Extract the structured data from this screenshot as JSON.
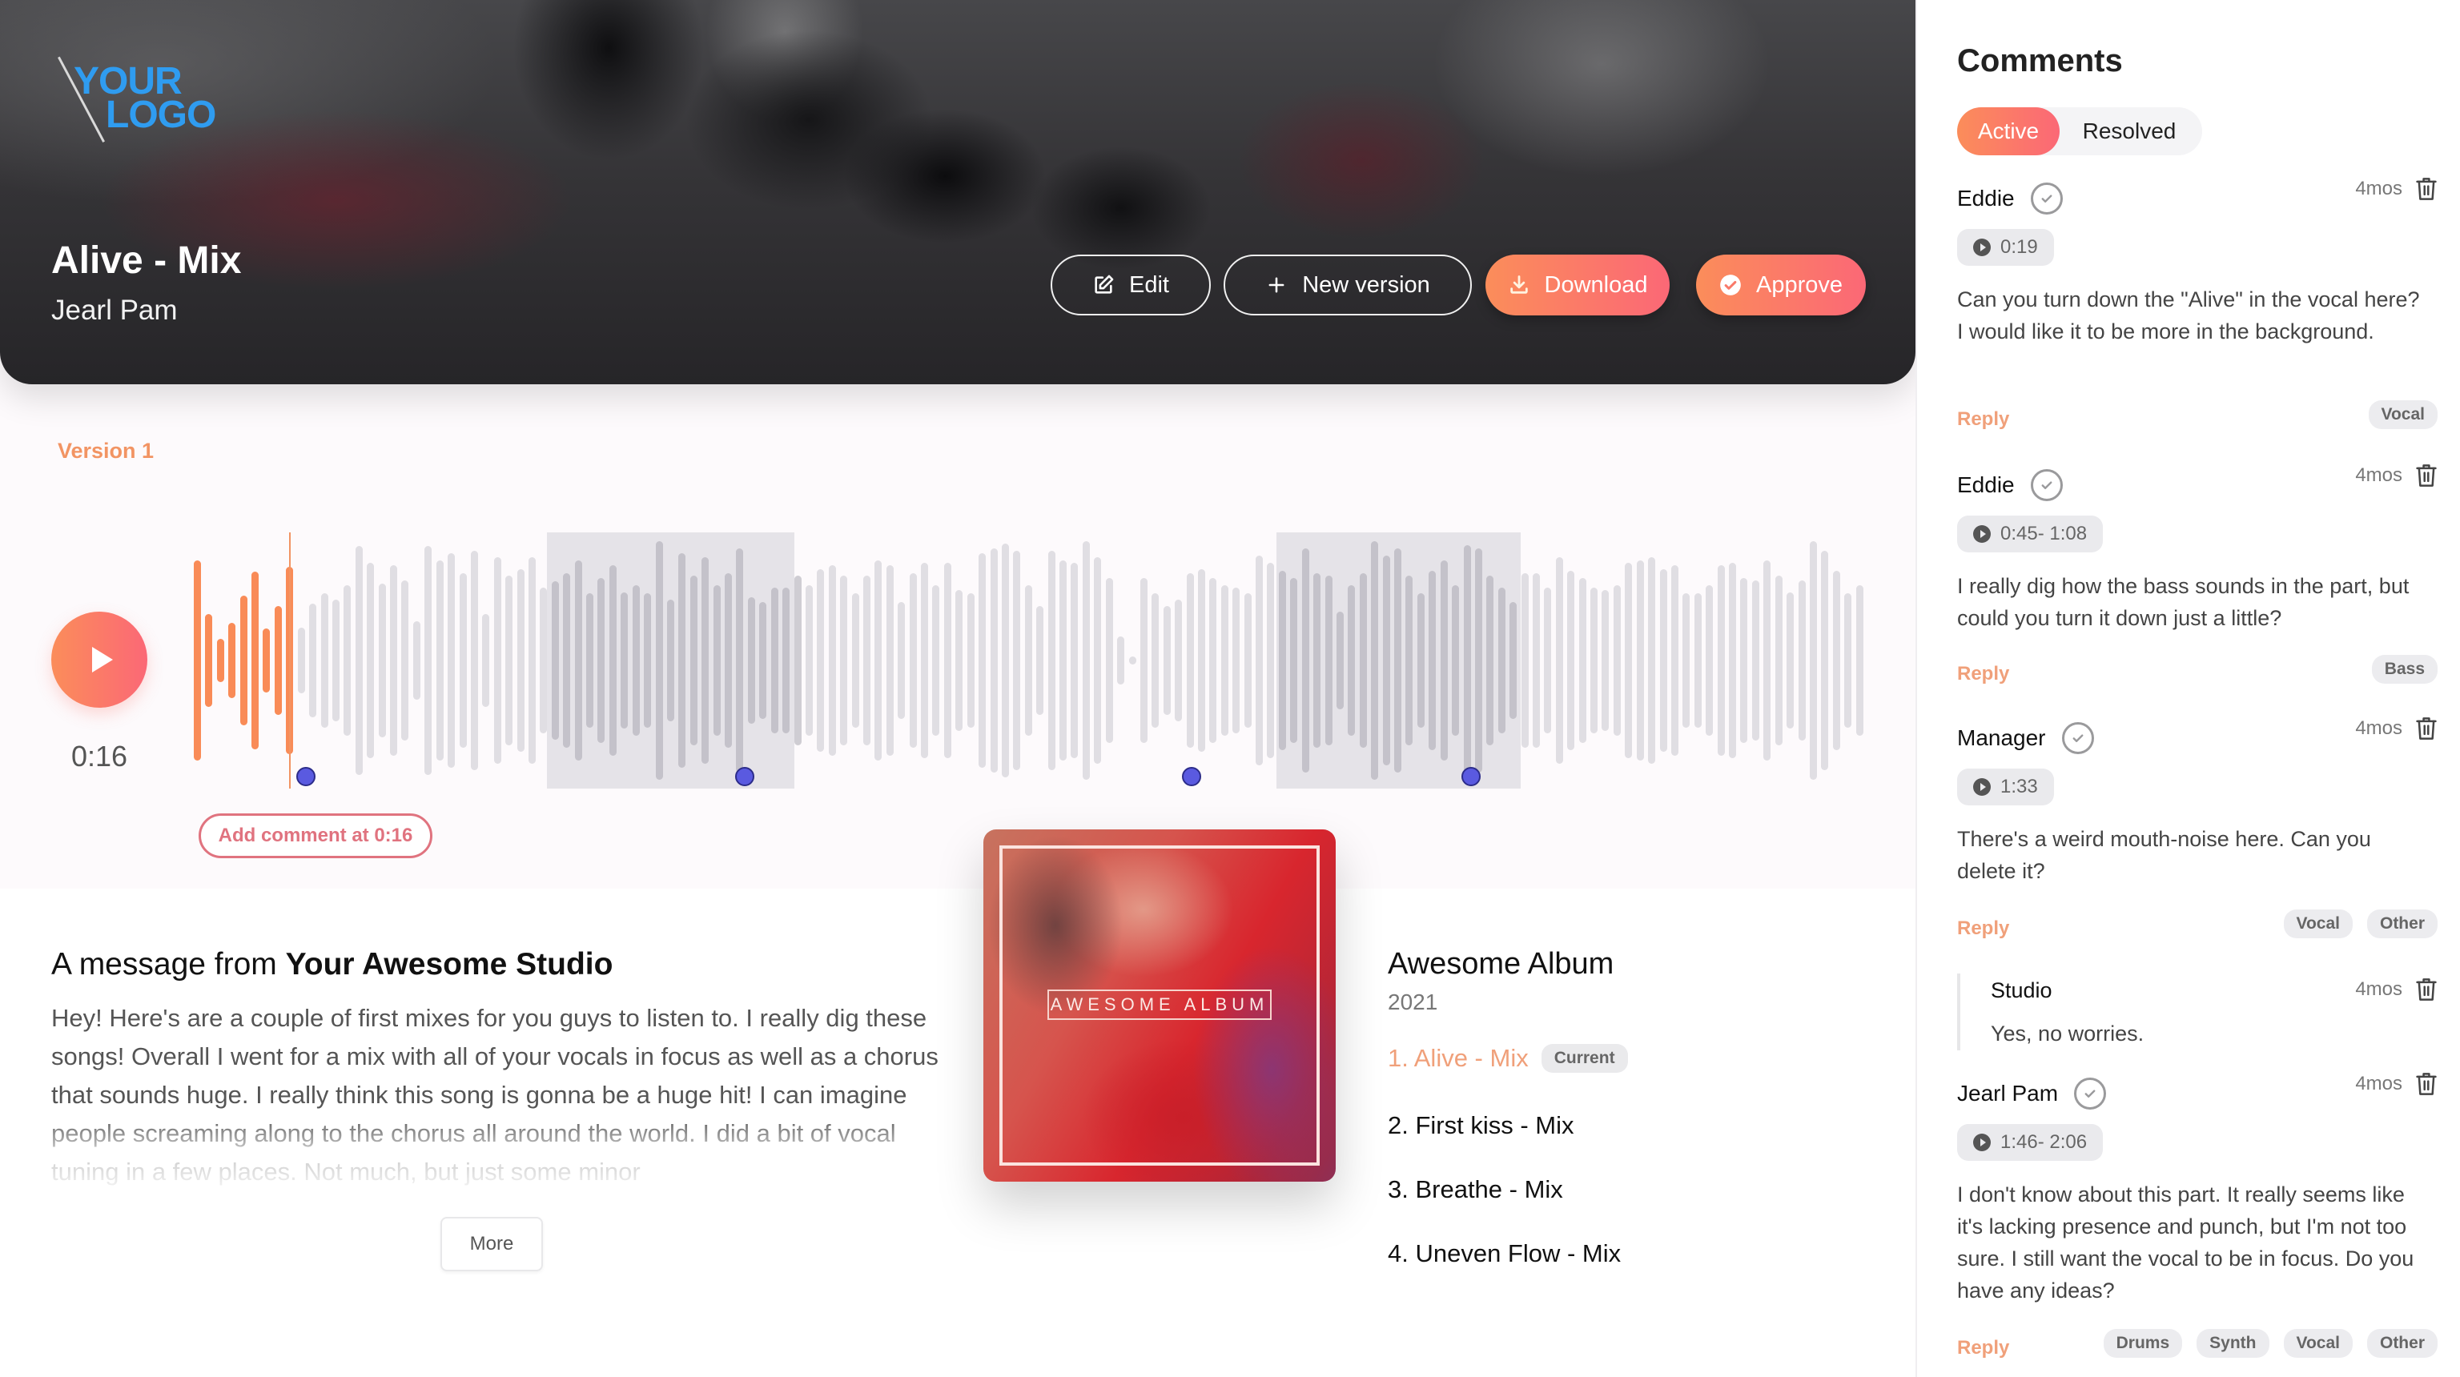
{
  "header": {
    "logo_line1": "YOUR",
    "logo_line2": "LOGO",
    "track_title": "Alive - Mix",
    "artist": "Jearl Pam",
    "buttons": {
      "edit": "Edit",
      "new_version": "New version",
      "download": "Download",
      "approve": "Approve"
    }
  },
  "player": {
    "version_label": "Version 1",
    "current_time": "0:16",
    "add_comment_label": "Add comment at 0:16",
    "progress_fraction": 0.058,
    "accent_color": "#f98b57",
    "marker_color": "#5a5ae0",
    "comment_markers": [
      0.068,
      0.33,
      0.597,
      0.764
    ],
    "comment_regions": [
      [
        0.212,
        0.36
      ],
      [
        0.648,
        0.794
      ]
    ],
    "waveform_amplitudes": [
      0.82,
      0.38,
      0.18,
      0.31,
      0.53,
      0.73,
      0.26,
      0.45,
      0.77,
      0.27,
      0.47,
      0.55,
      0.5,
      0.62,
      0.94,
      0.8,
      0.63,
      0.78,
      0.66,
      0.32,
      0.94,
      0.82,
      0.88,
      0.72,
      0.9,
      0.38,
      0.85,
      0.7,
      0.75,
      0.85,
      0.6,
      0.65,
      0.72,
      0.82,
      0.55,
      0.68,
      0.78,
      0.56,
      0.62,
      0.55,
      0.98,
      0.5,
      0.88,
      0.7,
      0.85,
      0.62,
      0.72,
      0.92,
      0.52,
      0.48,
      0.6,
      0.6,
      0.7,
      0.62,
      0.75,
      0.78,
      0.7,
      0.55,
      0.7,
      0.82,
      0.78,
      0.48,
      0.72,
      0.8,
      0.62,
      0.8,
      0.58,
      0.55,
      0.88,
      0.92,
      0.96,
      0.9,
      0.62,
      0.45,
      0.9,
      0.82,
      0.8,
      0.98,
      0.85,
      0.68,
      0.2,
      0.03,
      0.68,
      0.55,
      0.45,
      0.5,
      0.72,
      0.75,
      0.68,
      0.62,
      0.6,
      0.55,
      0.86,
      0.8,
      0.74,
      0.68,
      0.92,
      0.72,
      0.7,
      0.4,
      0.62,
      0.72,
      0.98,
      0.86,
      0.92,
      0.7,
      0.55,
      0.74,
      0.82,
      0.62,
      0.95,
      0.92,
      0.7,
      0.6,
      0.48,
      0.72,
      0.72,
      0.6,
      0.85,
      0.74,
      0.68,
      0.6,
      0.58,
      0.62,
      0.8,
      0.82,
      0.85,
      0.75,
      0.78,
      0.55,
      0.55,
      0.62,
      0.78,
      0.8,
      0.68,
      0.66,
      0.82,
      0.7,
      0.56,
      0.66,
      0.98,
      0.9,
      0.74,
      0.55,
      0.62
    ]
  },
  "message": {
    "heading_prefix": "A message from ",
    "heading_studio": "Your Awesome Studio",
    "body": "Hey! Here's are a couple of first mixes for you guys to listen to. I really dig these songs! Overall I went for a mix with all of your vocals in focus as well as a chorus that sounds huge. I really think this song is gonna be a huge hit! I can imagine people screaming along to the chorus all around the world. I did a bit of vocal tuning in a few places. Not much, but just some minor",
    "more_label": "More"
  },
  "album": {
    "cover_text": "AWESOME ALBUM",
    "title": "Awesome Album",
    "year": "2021",
    "tracks": [
      {
        "label": "1. Alive - Mix",
        "badge": "Current"
      },
      {
        "label": "2. First kiss - Mix"
      },
      {
        "label": "3. Breathe - Mix"
      },
      {
        "label": "4. Uneven Flow - Mix"
      }
    ]
  },
  "comments": {
    "title": "Comments",
    "tabs": {
      "active": "Active",
      "resolved": "Resolved"
    },
    "reply_label": "Reply",
    "items": [
      {
        "author": "Eddie",
        "time": "4mos",
        "timestamp": "0:19",
        "text": "Can you turn down the \"Alive\" in the vocal here? I would like it to be more in the background.",
        "tags": [
          "Vocal"
        ]
      },
      {
        "author": "Eddie",
        "time": "4mos",
        "timestamp": "0:45- 1:08",
        "text": "I really dig how the bass sounds in the part, but could you turn it down just a little?",
        "tags": [
          "Bass"
        ]
      },
      {
        "author": "Manager",
        "time": "4mos",
        "timestamp": "1:33",
        "text": "There's a weird mouth-noise here. Can you delete it?",
        "tags": [
          "Vocal",
          "Other"
        ],
        "reply": {
          "author": "Studio",
          "time": "4mos",
          "text": "Yes, no worries."
        }
      },
      {
        "author": "Jearl Pam",
        "time": "4mos",
        "timestamp": "1:46- 2:06",
        "text": "I don't know about this part. It really seems like it's lacking presence and punch, but I'm not too sure. I still want the vocal to be in focus. Do you have any ideas?",
        "tags": [
          "Drums",
          "Synth",
          "Vocal",
          "Other"
        ]
      }
    ]
  }
}
